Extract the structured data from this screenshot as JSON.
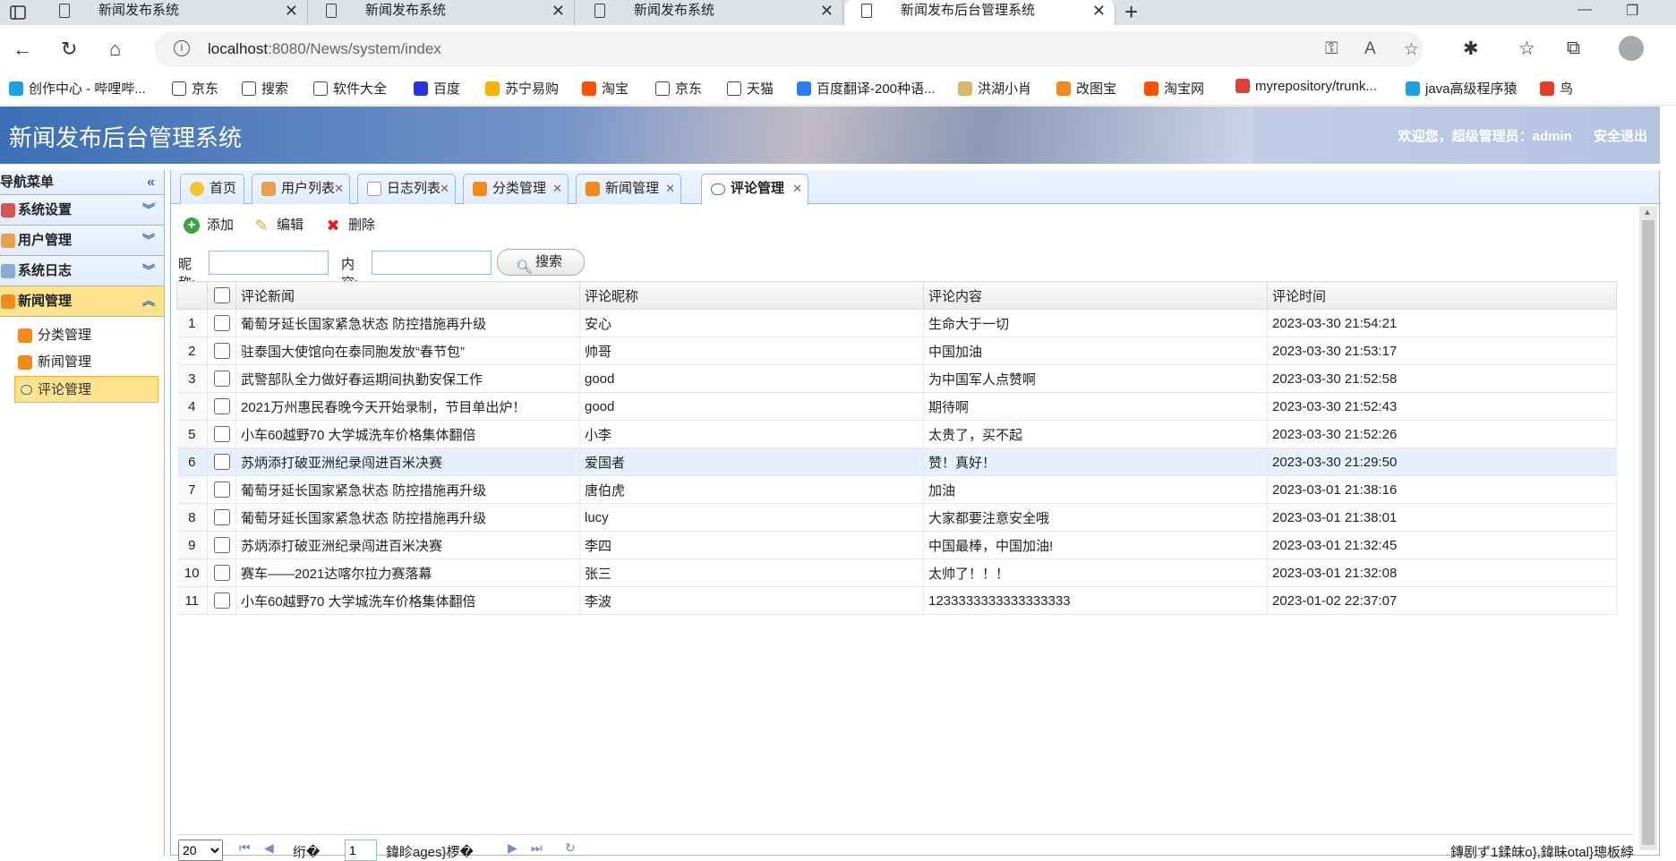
{
  "browser": {
    "tabs": [
      {
        "title": "新闻发布系统"
      },
      {
        "title": "新闻发布系统"
      },
      {
        "title": "新闻发布系统"
      },
      {
        "title": "新闻发布后台管理系统"
      }
    ],
    "url_host": "localhost",
    "url_rest": ":8080/News/system/index",
    "bookmarks": [
      {
        "label": "创作中心 - 哔哩哔...",
        "color": "#20a0e0"
      },
      {
        "label": "京东",
        "color": "#ffffff"
      },
      {
        "label": "搜索",
        "color": "#ffffff"
      },
      {
        "label": "软件大全",
        "color": "#ffffff"
      },
      {
        "label": "百度",
        "color": "#2932e1"
      },
      {
        "label": "苏宁易购",
        "color": "#f5b400"
      },
      {
        "label": "淘宝",
        "color": "#ff5000"
      },
      {
        "label": "京东",
        "color": "#ffffff"
      },
      {
        "label": "天猫",
        "color": "#ffffff"
      },
      {
        "label": "百度翻译-200种语...",
        "color": "#2c7cf6"
      },
      {
        "label": "洪湖小肖",
        "color": "#d9b66c"
      },
      {
        "label": "改图宝",
        "color": "#f08a1c"
      },
      {
        "label": "淘宝网",
        "color": "#ff5000"
      },
      {
        "label": "myrepository/trunk...",
        "color": "#db4437"
      },
      {
        "label": "java高级程序猿",
        "color": "#20a0e0"
      },
      {
        "label": "鸟",
        "color": "#e0402a"
      }
    ]
  },
  "header": {
    "title": "新闻发布后台管理系统",
    "welcome": "欢迎您，超级管理员：admin",
    "logout": "安全退出"
  },
  "nav": {
    "title": "导航菜单",
    "groups": [
      {
        "label": "系统设置",
        "color": "#d9534f"
      },
      {
        "label": "用户管理",
        "color": "#e8a04c"
      },
      {
        "label": "系统日志",
        "color": "#8aa9d6"
      },
      {
        "label": "新闻管理",
        "color": "#f08a1c"
      }
    ],
    "subitems": [
      {
        "label": "分类管理"
      },
      {
        "label": "新闻管理"
      },
      {
        "label": "评论管理"
      }
    ]
  },
  "tabs": [
    {
      "label": "首页",
      "color": "#f4c430"
    },
    {
      "label": "用户列表",
      "color": "#e8a04c"
    },
    {
      "label": "日志列表",
      "color": "#dddddd"
    },
    {
      "label": "分类管理",
      "color": "#f08a1c"
    },
    {
      "label": "新闻管理",
      "color": "#f08a1c"
    },
    {
      "label": "评论管理",
      "color": "#ffffff"
    }
  ],
  "toolbar": {
    "add": "添加",
    "edit": "编辑",
    "delete": "删除"
  },
  "search": {
    "nickname_label": "昵称:",
    "content_label": "内容:",
    "button": "搜索"
  },
  "table": {
    "columns": [
      "评论新闻",
      "评论昵称",
      "评论内容",
      "评论时间"
    ],
    "rows": [
      {
        "n": "1",
        "news": "葡萄牙延长国家紧急状态 防控措施再升级",
        "nick": "安心",
        "content": "生命大于一切",
        "time": "2023-03-30 21:54:21"
      },
      {
        "n": "2",
        "news": "驻泰国大使馆向在泰同胞发放“春节包”",
        "nick": "帅哥",
        "content": "中国加油",
        "time": "2023-03-30 21:53:17"
      },
      {
        "n": "3",
        "news": "武警部队全力做好春运期间执勤安保工作",
        "nick": "good",
        "content": "为中国军人点赞啊",
        "time": "2023-03-30 21:52:58"
      },
      {
        "n": "4",
        "news": "2021万州惠民春晚今天开始录制，节目单出炉！",
        "nick": "good",
        "content": "期待啊",
        "time": "2023-03-30 21:52:43"
      },
      {
        "n": "5",
        "news": "小车60越野70 大学城洗车价格集体翻倍",
        "nick": "小李",
        "content": "太贵了，买不起",
        "time": "2023-03-30 21:52:26"
      },
      {
        "n": "6",
        "news": "苏炳添打破亚洲纪录闯进百米决赛",
        "nick": "爱国者",
        "content": "赞！真好！",
        "time": "2023-03-30 21:29:50"
      },
      {
        "n": "7",
        "news": "葡萄牙延长国家紧急状态 防控措施再升级",
        "nick": "唐伯虎",
        "content": "加油",
        "time": "2023-03-01 21:38:16"
      },
      {
        "n": "8",
        "news": "葡萄牙延长国家紧急状态 防控措施再升级",
        "nick": "lucy",
        "content": "大家都要注意安全哦",
        "time": "2023-03-01 21:38:01"
      },
      {
        "n": "9",
        "news": "苏炳添打破亚洲纪录闯进百米决赛",
        "nick": "李四",
        "content": "中国最棒，中国加油!",
        "time": "2023-03-01 21:32:45"
      },
      {
        "n": "10",
        "news": "赛车——2021达喀尔拉力赛落幕",
        "nick": "张三",
        "content": "太帅了！！！",
        "time": "2023-03-01 21:32:08"
      },
      {
        "n": "11",
        "news": "小车60越野70 大学城洗车价格集体翻倍",
        "nick": "李波",
        "content": "1233333333333333333",
        "time": "2023-01-02 22:37:07"
      }
    ]
  },
  "pager": {
    "page_size": "20",
    "page_prefix": "绗�",
    "page_value": "1",
    "page_suffix": "鍏眕ages}椤�",
    "info": "鏄剧ず1鍒皌o},鍏眛otal}璁板綍"
  }
}
